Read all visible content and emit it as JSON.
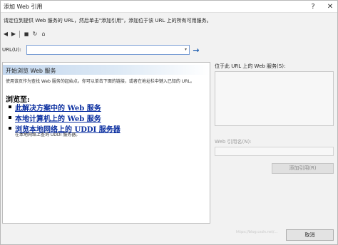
{
  "window": {
    "title": "添加 Web 引用",
    "help_glyph": "?",
    "close_glyph": "✕"
  },
  "instruction": "请定位到提供 Web 服务的 URL，然后单击\"添加引用\"，添加位于该 URL 上的所有可用服务。",
  "toolbar": {
    "back_icon": "◀",
    "forward_icon": "▶",
    "stop_icon": "■",
    "refresh_icon": "↻",
    "home_icon": "⌂"
  },
  "url": {
    "label": "URL(U):",
    "value": "",
    "dropdown_glyph": "▾",
    "go_glyph": "→"
  },
  "browser": {
    "header": "开始浏览 Web 服务",
    "description": "使用该页作为查找 Web 服务的起始点。你可以单击下面的链接，或者在地址栏中键入已知的 URL。",
    "browse_to": "浏览至:",
    "links": [
      {
        "label": "此解决方案中的 Web 服务"
      },
      {
        "label": "本地计算机上的 Web 服务"
      },
      {
        "label": "浏览本地网络上的 UDDI 服务器"
      }
    ],
    "uddi_sub": "在本地网络上查询 UDDI 服务器。"
  },
  "services": {
    "label": "位于此 URL 上的 Web 服务(S):"
  },
  "reference_name": {
    "label": "Web 引用名(N):",
    "value": ""
  },
  "buttons": {
    "add_reference": "添加引用(R)",
    "cancel": "取消"
  },
  "watermark": "https://blog.csdn.net/..."
}
